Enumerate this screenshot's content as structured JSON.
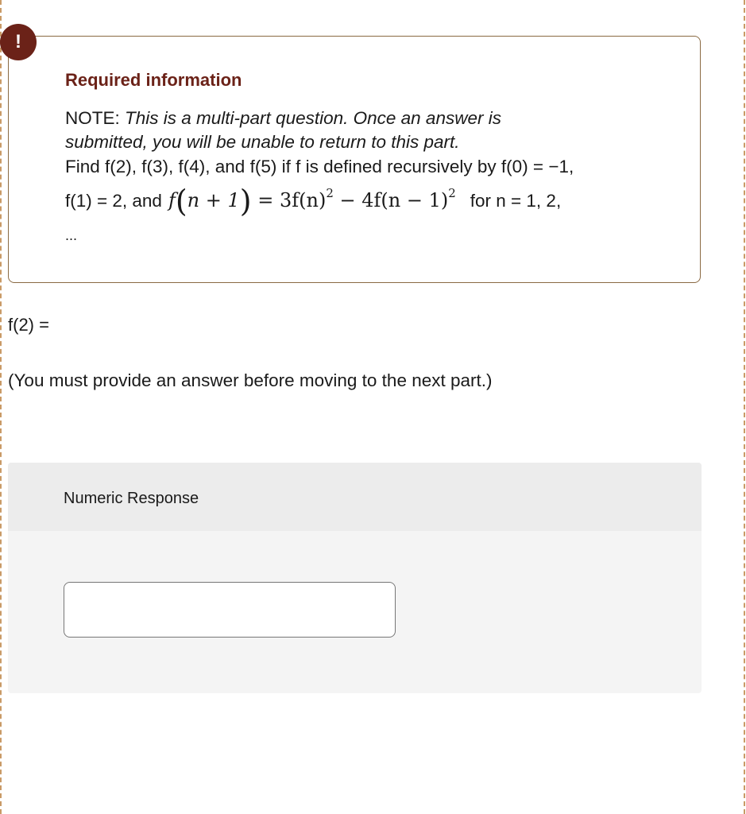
{
  "alert": {
    "icon": "exclamation-icon",
    "symbol": "!",
    "color": "#6b2218"
  },
  "info": {
    "title": "Required information",
    "note_prefix": "NOTE: ",
    "note_italic_1": "This is a multi-part question. Once an answer is",
    "note_italic_2": "submitted, you will be unable to return to this part.",
    "find_text": "Find f(2), f(3), f(4), and f(5) if f is defined recursively by f(0) = −1,",
    "line4_prefix": "f(1) = 2, and",
    "formula": {
      "lhs_f": "f",
      "lhs_arg": "n + 1",
      "rhs_a": "= 3f(n)",
      "rhs_a_exp": "2",
      "rhs_b": " − 4f(n − 1)",
      "rhs_b_exp": "2"
    },
    "line4_suffix": "for n = 1, 2,",
    "ellipsis": "..."
  },
  "question": {
    "prompt": "f(2) =",
    "warning": "(You must provide an answer before moving to the next part.)"
  },
  "response": {
    "label": "Numeric Response",
    "value": "",
    "placeholder": ""
  }
}
